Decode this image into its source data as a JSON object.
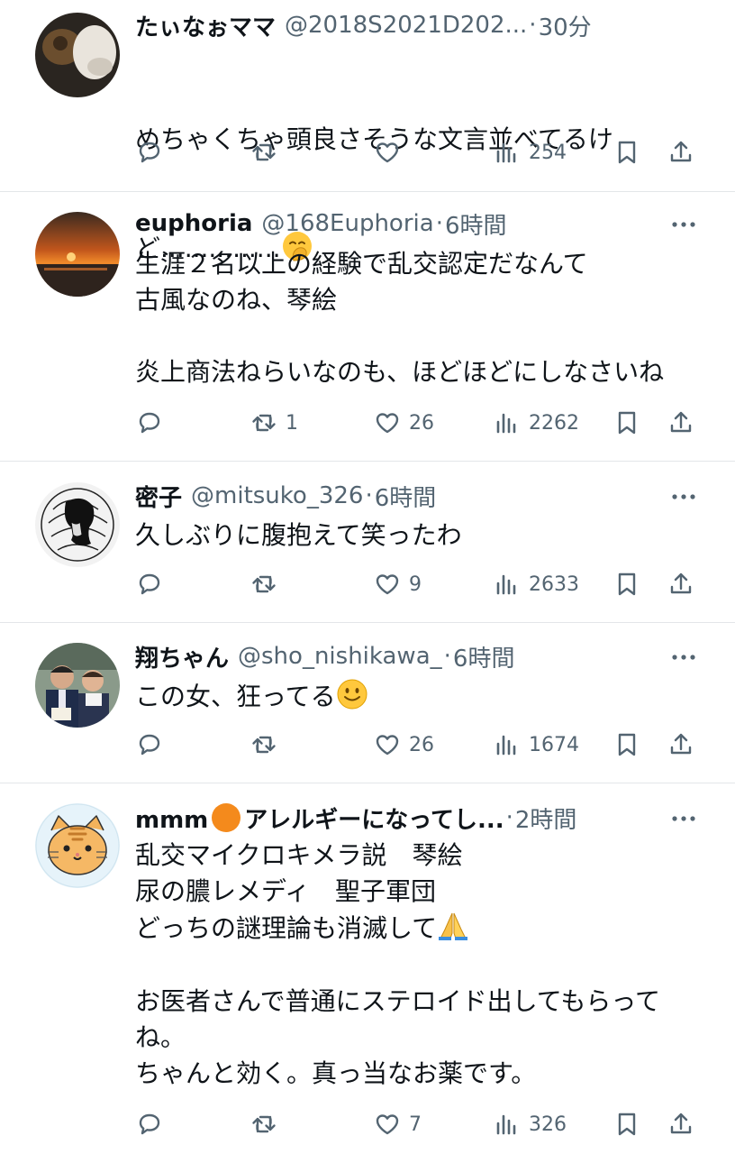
{
  "tweets": [
    {
      "name": "たぃなぉママ",
      "handle": "@2018S2021D202...",
      "dot": "·",
      "time": "30分",
      "text_lines": [
        "めちゃくちゃ頭良さそうな文言並べてるけ",
        "ど..............."
      ],
      "emoji": "hand-over-mouth-emoji",
      "replies": "",
      "retweets": "",
      "likes": "",
      "views": "254"
    },
    {
      "name": "euphoria",
      "handle": "@168Euphoria",
      "dot": "·",
      "time": "6時間",
      "text": "生涯２名以上の経験で乱交認定だなんて\n古風なのね、琴絵\n\n炎上商法ねらいなのも、ほどほどにしなさいね",
      "replies": "",
      "retweets": "1",
      "likes": "26",
      "views": "2262"
    },
    {
      "name": "密子",
      "handle": "@mitsuko_326",
      "dot": "·",
      "time": "6時間",
      "text": "久しぶりに腹抱えて笑ったわ",
      "replies": "",
      "retweets": "",
      "likes": "9",
      "views": "2633"
    },
    {
      "name": "翔ちゃん",
      "handle": "@sho_nishikawa_",
      "dot": "·",
      "time": "6時間",
      "text": "この女、狂ってる",
      "emoji": "slightly-smiling-face-emoji",
      "replies": "",
      "retweets": "",
      "likes": "26",
      "views": "1674"
    },
    {
      "name_prefix": "mmm",
      "name_suffix": "アレルギーになってし...",
      "dot": "·",
      "time": "2時間",
      "text": "乱交マイクロキメラ説　琴絵\n尿の膿レメディ　聖子軍団\nどっちの謎理論も消滅して",
      "text2": "お医者さんで普通にステロイド出してもらって\nね。\nちゃんと効く。真っ当なお薬です。",
      "emoji": "folded-hands-emoji",
      "replies": "",
      "retweets": "",
      "likes": "7",
      "views": "326"
    }
  ],
  "colors": {
    "text": "#0f1419",
    "secondary": "#536471",
    "divider": "#e3e6e9"
  }
}
